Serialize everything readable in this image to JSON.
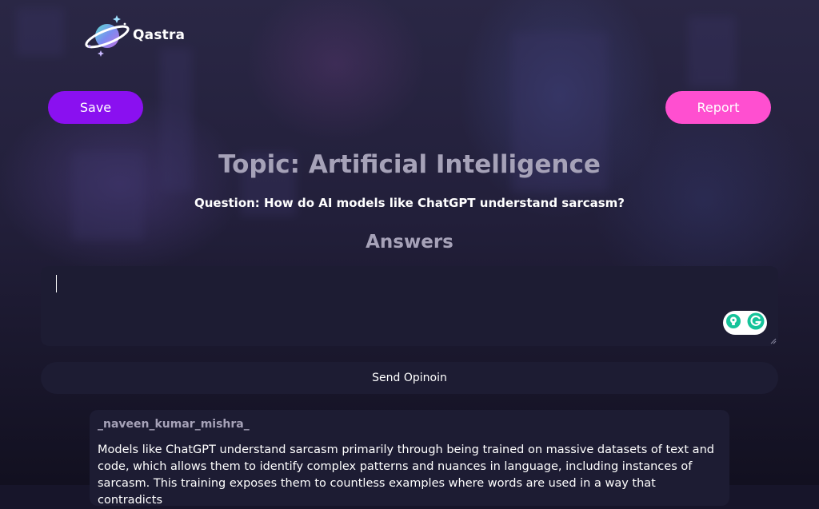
{
  "brand": {
    "name": "Qastra",
    "icon": "planet-logo"
  },
  "actions": {
    "save_label": "Save",
    "report_label": "Report"
  },
  "topic": "Topic: Artificial Intelligence",
  "question": "Question: How do AI models like ChatGPT understand sarcasm?",
  "answers_heading": "Answers",
  "answer_input": {
    "value": "",
    "placeholder": ""
  },
  "send_label": "Send Opinoin",
  "answers": [
    {
      "username": "_naveen_kumar_mishra_",
      "text": "Models like ChatGPT understand sarcasm primarily through being trained on massive datasets of text and code, which allows them to identify complex patterns and nuances in language, including instances of sarcasm. This training exposes them to countless examples where words are used in a way that contradicts"
    }
  ],
  "colors": {
    "save": "#8a10f0",
    "report": "#ff4fd0",
    "panel": "#1d1c33",
    "muted_heading": "#a6a2b8"
  }
}
